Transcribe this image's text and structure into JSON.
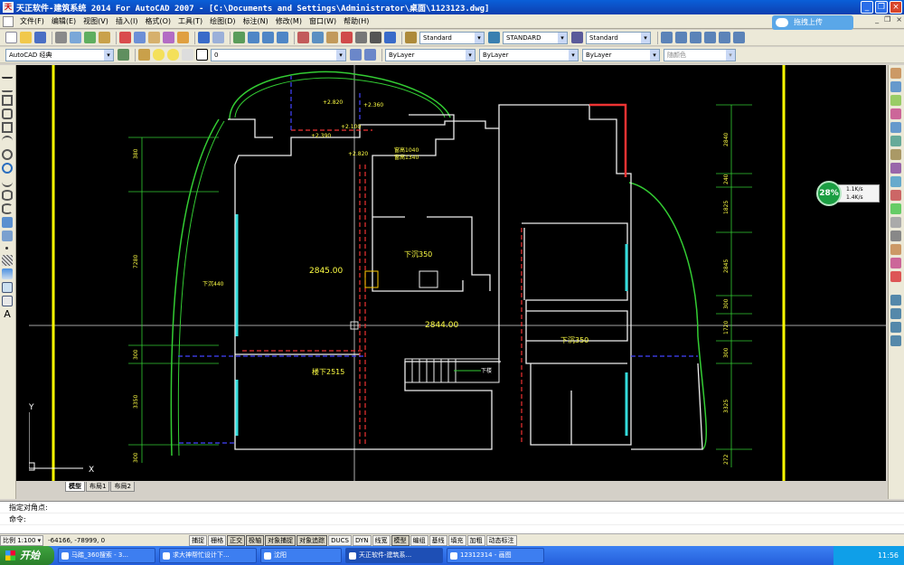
{
  "window": {
    "title": "天正软件-建筑系统 2014  For AutoCAD 2007 - [C:\\Documents and Settings\\Administrator\\桌面\\1123123.dwg]",
    "upload_label": "拖拽上传",
    "mdi_min": "_",
    "mdi_restore": "❐",
    "mdi_close": "×"
  },
  "menu": [
    "文件(F)",
    "编辑(E)",
    "视图(V)",
    "插入(I)",
    "格式(O)",
    "工具(T)",
    "绘图(D)",
    "标注(N)",
    "修改(M)",
    "窗口(W)",
    "帮助(H)"
  ],
  "toolbar": {
    "text_style": "Standard",
    "dim_style": "STANDARD",
    "table_style": "Standard",
    "workspace": "AutoCAD 经典",
    "layer": "0",
    "color": "ByLayer",
    "linetype": "ByLayer",
    "lineweight": "ByLayer",
    "plot_style": "随颜色"
  },
  "drawing": {
    "levels": [
      "+2.820",
      "+2.360",
      "+2.390",
      "+2.100",
      "+2.820"
    ],
    "heights": [
      "窗高1040",
      "窗高1340"
    ],
    "areas": [
      "2845.00",
      "2844.00"
    ],
    "notes": [
      "下沉350",
      "下沉440",
      "下沉350",
      "楼下2515",
      "下楼"
    ],
    "dims_left": [
      "380",
      "7280",
      "300",
      "3350",
      "300"
    ],
    "dims_right": [
      "2840",
      "240",
      "1825",
      "2845",
      "300",
      "1720",
      "300",
      "3325",
      "272"
    ]
  },
  "tabs": [
    "模型",
    "布局1",
    "布局2"
  ],
  "command": {
    "line1": "指定对角点:",
    "prompt": "命令:"
  },
  "status": {
    "scale": "比例 1:100 ▾",
    "coords": "-64166, -78999, 0",
    "buttons": [
      "捕捉",
      "栅格",
      "正交",
      "极轴",
      "对象捕捉",
      "对象追踪",
      "DUCS",
      "DYN",
      "线宽",
      "模型",
      "编组",
      "基线",
      "填充",
      "加粗",
      "动态标注"
    ],
    "active": [
      "正交",
      "极轴",
      "对象捕捉",
      "对象追踪",
      "模型"
    ]
  },
  "taskbar": {
    "start": "开始",
    "tasks": [
      "马踏_360搜索 - 3...",
      "求大神帮忙设计下...",
      "沈阳",
      "天正软件-建筑系...",
      "12312314 - 画图"
    ],
    "active_task": 3,
    "clock": "11:56"
  },
  "network": {
    "percent": "28%",
    "up": "1.1K/s",
    "down": "1.4K/s"
  }
}
